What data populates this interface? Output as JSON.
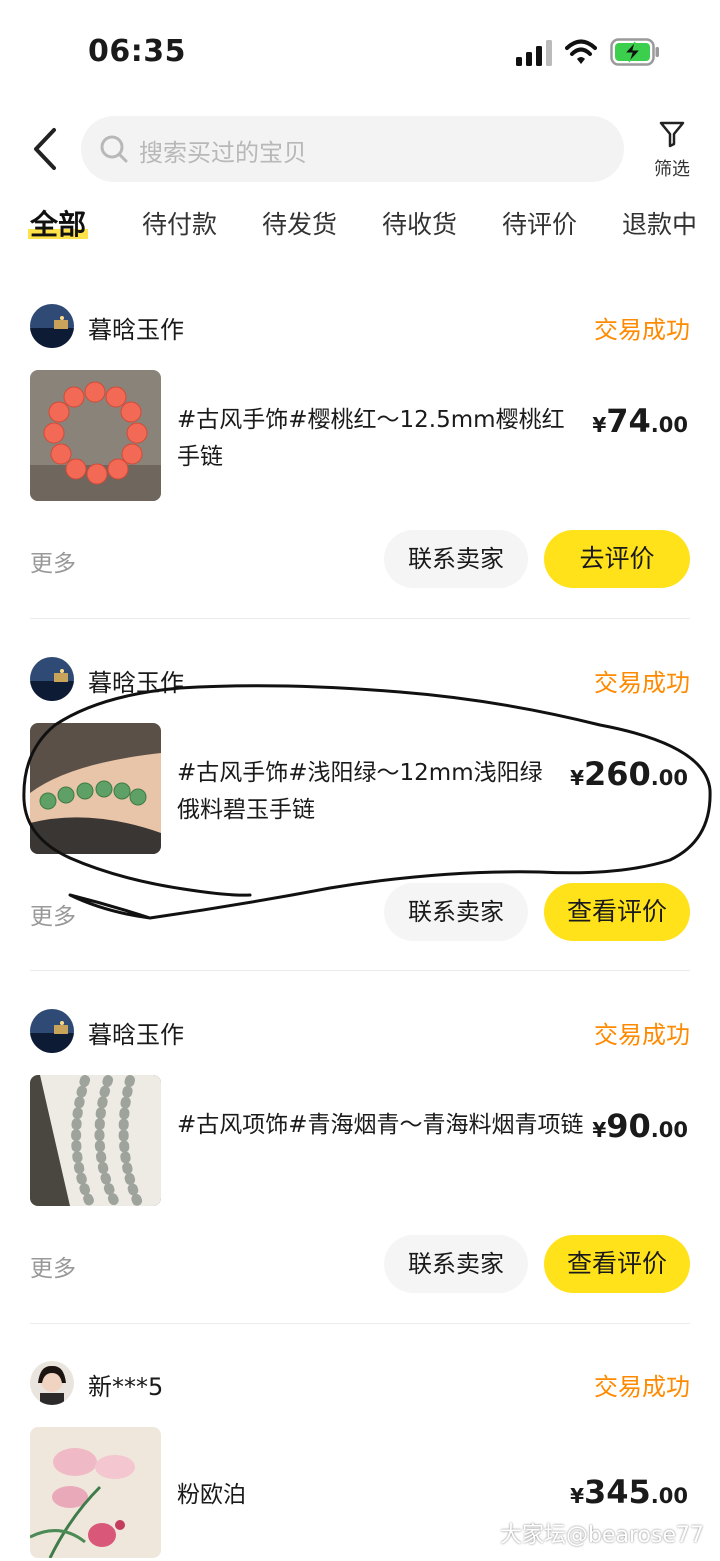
{
  "status_bar": {
    "time": "06:35"
  },
  "search": {
    "placeholder": "搜索买过的宝贝"
  },
  "filter": {
    "label": "筛选"
  },
  "tabs": [
    {
      "label": "全部",
      "active": true
    },
    {
      "label": "待付款"
    },
    {
      "label": "待发货"
    },
    {
      "label": "待收货"
    },
    {
      "label": "待评价"
    },
    {
      "label": "退款中"
    }
  ],
  "orders": [
    {
      "shop": "暮晗玉作",
      "status": "交易成功",
      "title": "#古风手饰#樱桃红～12.5mm樱桃红手链",
      "price": {
        "currency": "¥",
        "integer": "74",
        "decimal": ".00"
      },
      "more": "更多",
      "contact": "联系卖家",
      "action": "去评价"
    },
    {
      "shop": "暮晗玉作",
      "status": "交易成功",
      "title": "#古风手饰#浅阳绿～12mm浅阳绿俄料碧玉手链",
      "price": {
        "currency": "¥",
        "integer": "260",
        "decimal": ".00"
      },
      "more": "更多",
      "contact": "联系卖家",
      "action": "查看评价"
    },
    {
      "shop": "暮晗玉作",
      "status": "交易成功",
      "title": "#古风项饰#青海烟青～青海料烟青项链",
      "price": {
        "currency": "¥",
        "integer": "90",
        "decimal": ".00"
      },
      "more": "更多",
      "contact": "联系卖家",
      "action": "查看评价"
    },
    {
      "shop": "新***5",
      "status": "交易成功",
      "title": "粉欧泊",
      "price": {
        "currency": "¥",
        "integer": "345",
        "decimal": ".00"
      }
    }
  ],
  "watermark": "大家坛@bearose77",
  "colors": {
    "accent_yellow": "#ffe21a",
    "status_orange": "#ff8a00",
    "search_bg": "#f3f3f3"
  }
}
